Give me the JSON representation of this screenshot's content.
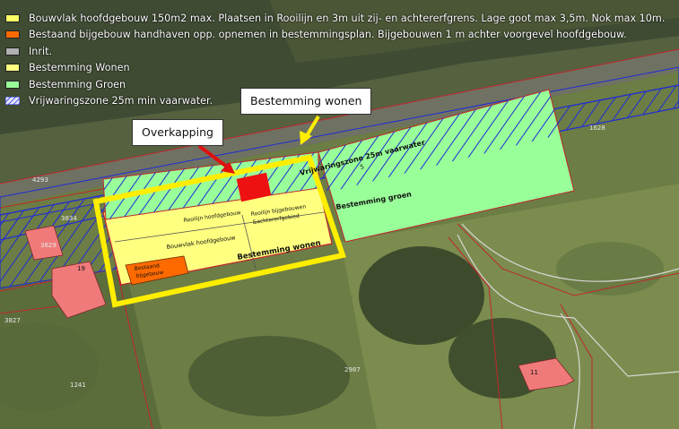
{
  "legend": {
    "items": [
      {
        "label": "Bouwvlak hoofdgebouw 150m2 max. Plaatsen in Rooilijn en 3m uit zij- en achtererfgrens. Lage goot max 3,5m. Nok max 10m.",
        "color": "#ffff66"
      },
      {
        "label": "Bestaand bijgebouw handhaven opp. opnemen in bestemmingsplan. Bijgebouwen 1 m achter voorgevel hoofdgebouw.",
        "color": "#ff6a00"
      },
      {
        "label": "Inrit.",
        "color": "#b0b0b0"
      },
      {
        "label": "Bestemming Wonen",
        "color": "#ffff80"
      },
      {
        "label": "Bestemming Groen",
        "color": "#99ff99"
      },
      {
        "label": "Vrijwaringszone 25m min vaarwater.",
        "color": "#1f2bd6"
      }
    ]
  },
  "callouts": {
    "bestemming_wonen": "Bestemming wonen",
    "overkapping": "Overkapping"
  },
  "map_labels": {
    "bouwvlak": "Bouwvlak hoofdgebouw",
    "bestaand_bijgebouw_1": "Bestaand",
    "bestaand_bijgebouw_2": "bijgebouw",
    "rooilijn_1": "Rooilijn bijgebouwen",
    "rooilijn_2": "&achtererfgebied",
    "bestemming_wonen": "Bestemming wonen",
    "bestemming_groen": "Bestemming groen",
    "vrijwaringszone": "Vrijwaringszone 25m vaarwater",
    "vrijwaringszone_sub": "5",
    "rooilijn_hoofd": "Rooilijn hoofdgebouw",
    "parcel_4293": "4293",
    "parcel_3834": "3834",
    "parcel_3827": "3827",
    "parcel_3629": "3629",
    "parcel_1241": "1241",
    "parcel_2987": "2987",
    "parcel_1628": "1628",
    "house_19": "19",
    "house_11": "11"
  }
}
